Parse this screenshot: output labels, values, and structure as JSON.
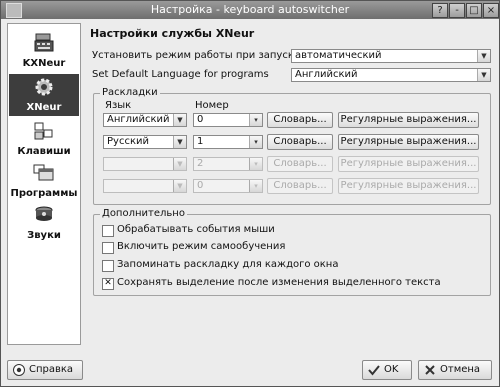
{
  "window": {
    "title": "Настройка - keyboard autoswitcher"
  },
  "titlebar_buttons": [
    "?",
    "-",
    "□",
    "×"
  ],
  "sidebar": {
    "items": [
      {
        "label": "KXNeur",
        "icon": "keyboard-flag-icon",
        "active": false
      },
      {
        "label": "XNeur",
        "icon": "gear-icon",
        "active": true
      },
      {
        "label": "Клавиши",
        "icon": "keys-icon",
        "active": false
      },
      {
        "label": "Программы",
        "icon": "programs-icon",
        "active": false
      },
      {
        "label": "Звуки",
        "icon": "speaker-icon",
        "active": false
      }
    ]
  },
  "main": {
    "section_title": "Настройки службы XNeur",
    "startup_mode": {
      "label": "Установить режим работы при запуске",
      "value": "автоматический"
    },
    "default_language": {
      "label": "Set Default Language for programs",
      "value": "Английский"
    },
    "layouts": {
      "legend": "Раскладки",
      "col_language": "Язык",
      "col_number": "Номер",
      "rows": [
        {
          "language": "Английский",
          "number": "0",
          "dict": "Словарь...",
          "regex": "Регулярные выражения...",
          "enabled": true
        },
        {
          "language": "Русский",
          "number": "1",
          "dict": "Словарь...",
          "regex": "Регулярные выражения...",
          "enabled": true
        },
        {
          "language": "",
          "number": "2",
          "dict": "Словарь...",
          "regex": "Регулярные выражения...",
          "enabled": false
        },
        {
          "language": "",
          "number": "0",
          "dict": "Словарь...",
          "regex": "Регулярные выражения...",
          "enabled": false
        }
      ]
    },
    "extra": {
      "legend": "Дополнительно",
      "options": [
        {
          "label": "Обрабатывать события мыши",
          "checked": false
        },
        {
          "label": "Включить режим самообучения",
          "checked": false
        },
        {
          "label": "Запоминать раскладку для каждого окна",
          "checked": false
        },
        {
          "label": "Сохранять выделение после изменения выделенного текста",
          "checked": true
        }
      ]
    }
  },
  "footer": {
    "help_label": "Справка",
    "ok_label": "OK",
    "cancel_label": "Отмена"
  }
}
